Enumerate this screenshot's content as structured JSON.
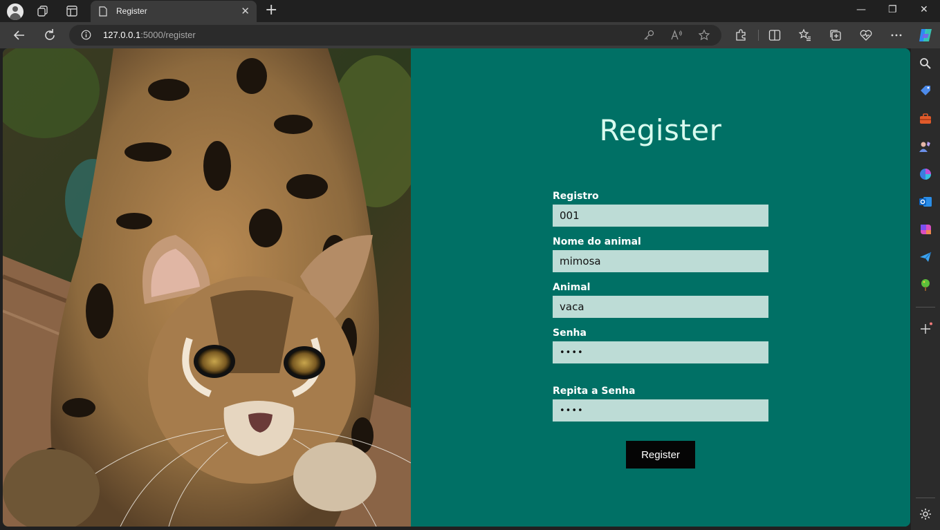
{
  "browser": {
    "tab_title": "Register",
    "tab_close_glyph": "✕",
    "new_tab_glyph": "+",
    "url_host": "127.0.0.1",
    "url_path": ":5000/register",
    "window_controls": {
      "minimize": "—",
      "restore": "❐",
      "close": "✕"
    },
    "icons": [
      "profile-icon",
      "workspaces-icon",
      "tab-actions-icon",
      "page-icon",
      "back-icon",
      "refresh-icon",
      "info-icon",
      "key-icon",
      "read-aloud-icon",
      "favorite-star-icon",
      "extensions-icon",
      "split-screen-icon",
      "favorites-icon",
      "collections-icon",
      "browser-essentials-icon",
      "more-icon",
      "copilot-icon"
    ]
  },
  "sidebar": {
    "icons": [
      "search-icon",
      "shopping-tag-icon",
      "tools-icon",
      "games-icon",
      "copilot-icon",
      "outlook-icon",
      "designer-icon",
      "send-icon",
      "tree-icon",
      "add-icon",
      "settings-icon"
    ]
  },
  "page": {
    "photo_alt": "ocelot",
    "title": "Register",
    "fields": [
      {
        "label": "Registro",
        "value": "001",
        "type": "text"
      },
      {
        "label": "Nome do animal",
        "value": "mimosa",
        "type": "text"
      },
      {
        "label": "Animal",
        "value": "vaca",
        "type": "text"
      },
      {
        "label": "Senha",
        "value": "••••",
        "type": "password"
      },
      {
        "label": "Repita a Senha",
        "value": "••••",
        "type": "password"
      }
    ],
    "submit_label": "Register"
  },
  "colors": {
    "panel_bg": "#007065",
    "title": "#d8fbef",
    "input_bg": "#bddcd6",
    "button_bg": "#050505"
  }
}
